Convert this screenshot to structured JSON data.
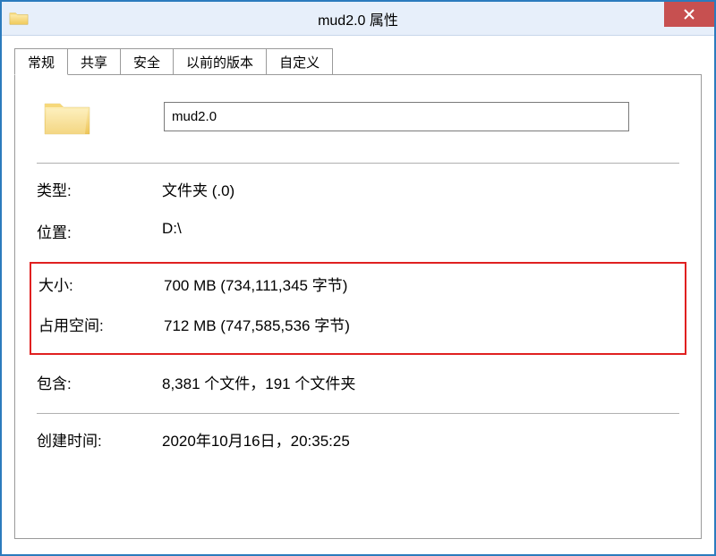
{
  "window": {
    "title": "mud2.0 属性"
  },
  "tabs": {
    "general": "常规",
    "sharing": "共享",
    "security": "安全",
    "previous": "以前的版本",
    "custom": "自定义"
  },
  "fields": {
    "name_value": "mud2.0",
    "type_label": "类型:",
    "type_value": "文件夹 (.0)",
    "location_label": "位置:",
    "location_value": "D:\\",
    "size_label": "大小:",
    "size_value": "700 MB (734,111,345 字节)",
    "sizeondisk_label": "占用空间:",
    "sizeondisk_value": "712 MB (747,585,536 字节)",
    "contains_label": "包含:",
    "contains_value": "8,381 个文件，191 个文件夹",
    "created_label": "创建时间:",
    "created_value": "2020年10月16日，20:35:25"
  }
}
